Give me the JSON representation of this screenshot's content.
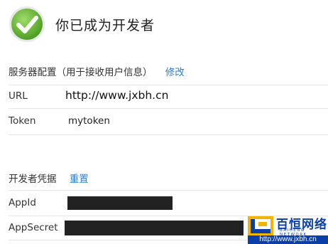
{
  "header": {
    "title": "你已成为开发者",
    "icon": "check-icon"
  },
  "server_config": {
    "title": "服务器配置（用于接收用户信息）",
    "edit_link": "修改",
    "url_label": "URL",
    "url_value": "http://www.jxbh.cn",
    "token_label": "Token",
    "token_value": "mytoken"
  },
  "credentials": {
    "title": "开发者凭据",
    "reset_link": "重置",
    "appid_label": "AppId",
    "appsecret_label": "AppSecret"
  },
  "watermark": {
    "brand": "百恒网络",
    "subtitle": "BAIHENG NETWORK",
    "url": "http://www.jxbh.cn"
  },
  "colors": {
    "link": "#2f7fd0",
    "check_green": "#5fb531",
    "watermark_blue": "#0a3ea8"
  }
}
